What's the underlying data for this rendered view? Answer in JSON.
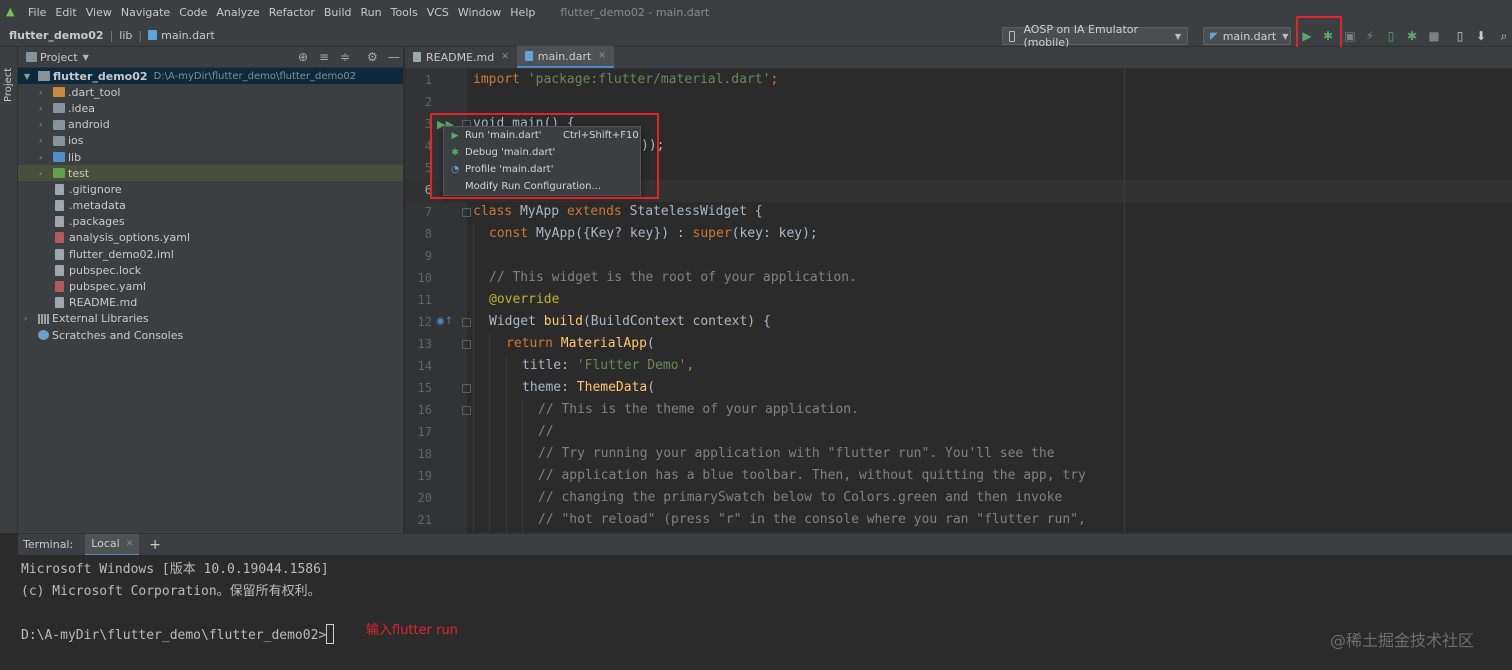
{
  "menubar": {
    "app_icon": "android-studio-icon",
    "items": [
      "File",
      "Edit",
      "View",
      "Navigate",
      "Code",
      "Analyze",
      "Refactor",
      "Build",
      "Run",
      "Tools",
      "VCS",
      "Window",
      "Help"
    ],
    "window_title": "flutter_demo02 - main.dart"
  },
  "navbar": {
    "breadcrumb": [
      "flutter_demo02",
      "lib",
      "main.dart"
    ],
    "device_selector": "AOSP on IA Emulator (mobile)",
    "run_config": "main.dart",
    "icons": [
      "run-icon",
      "debug-icon",
      "run-coverage-icon",
      "attach-icon",
      "apply-changes-icon",
      "debugger-icon",
      "stop-icon",
      "device-manager-icon",
      "sdk-manager-icon",
      "search-icon"
    ]
  },
  "stripe": {
    "label": "Project"
  },
  "project": {
    "title": "Project",
    "tree": [
      {
        "label": "flutter_demo02",
        "hint": "D:\\A-myDir\\flutter_demo\\flutter_demo02",
        "icon": "folder",
        "level": 0,
        "expanded": true
      },
      {
        "label": ".dart_tool",
        "icon": "folder-orange",
        "level": 1
      },
      {
        "label": ".idea",
        "icon": "folder",
        "level": 1
      },
      {
        "label": "android",
        "icon": "folder",
        "level": 1
      },
      {
        "label": "ios",
        "icon": "folder",
        "level": 1
      },
      {
        "label": "lib",
        "icon": "folder-blue",
        "level": 1
      },
      {
        "label": "test",
        "icon": "folder-green",
        "level": 1
      },
      {
        "label": ".gitignore",
        "icon": "file",
        "level": 1
      },
      {
        "label": ".metadata",
        "icon": "file",
        "level": 1
      },
      {
        "label": ".packages",
        "icon": "file",
        "level": 1
      },
      {
        "label": "analysis_options.yaml",
        "icon": "file-yaml",
        "level": 1
      },
      {
        "label": "flutter_demo02.iml",
        "icon": "file",
        "level": 1
      },
      {
        "label": "pubspec.lock",
        "icon": "file",
        "level": 1
      },
      {
        "label": "pubspec.yaml",
        "icon": "file-yaml",
        "level": 1
      },
      {
        "label": "README.md",
        "icon": "file",
        "level": 1
      },
      {
        "label": "External Libraries",
        "icon": "library",
        "level": 0
      },
      {
        "label": "Scratches and Consoles",
        "icon": "scratch",
        "level": 0
      }
    ]
  },
  "editor": {
    "tabs": [
      {
        "label": "README.md",
        "active": false
      },
      {
        "label": "main.dart",
        "active": true
      }
    ],
    "line_numbers": [
      "1",
      "2",
      "3",
      "4",
      "5",
      "6",
      "7",
      "8",
      "9",
      "10",
      "11",
      "12",
      "13",
      "14",
      "15",
      "16",
      "17",
      "18",
      "19",
      "20",
      "21"
    ],
    "code": {
      "l1a": "import ",
      "l1b": "'package:flutter/material.dart'",
      "l1c": ";",
      "l3": "void main() {",
      "l4": "));",
      "l7a": "class ",
      "l7b": "MyApp ",
      "l7c": "extends ",
      "l7d": "StatelessWidget {",
      "l8a": "const ",
      "l8b": "MyApp({Key? key}) : ",
      "l8c": "super",
      "l8d": "(key: key);",
      "l10": "// This widget is the root of your application.",
      "l11": "@override",
      "l12a": "Widget ",
      "l12b": "build",
      "l12c": "(BuildContext context) {",
      "l13a": "return ",
      "l13b": "MaterialApp",
      "l13c": "(",
      "l14a": "title: ",
      "l14b": "'Flutter Demo'",
      "l14c": ",",
      "l15a": "theme: ",
      "l15b": "ThemeData",
      "l15c": "(",
      "l16": "// This is the theme of your application.",
      "l17": "//",
      "l18": "// Try running your application with \"flutter run\". You'll see the",
      "l19": "// application has a blue toolbar. Then, without quitting the app, try",
      "l20": "// changing the primarySwatch below to Colors.green and then invoke",
      "l21": "// \"hot reload\" (press \"r\" in the console where you ran \"flutter run\","
    }
  },
  "popup": {
    "items": [
      {
        "label": "Run 'main.dart'",
        "shortcut": "Ctrl+Shift+F10",
        "icon": "run-icon"
      },
      {
        "label": "Debug 'main.dart'",
        "shortcut": "",
        "icon": "debug-icon"
      },
      {
        "label": "Profile 'main.dart'",
        "shortcut": "",
        "icon": "profile-icon"
      },
      {
        "label": "Modify Run Configuration...",
        "shortcut": "",
        "icon": ""
      }
    ]
  },
  "terminal": {
    "title": "Terminal:",
    "tab": "Local",
    "lines": [
      "Microsoft Windows [版本 10.0.19044.1586]",
      "(c) Microsoft Corporation。保留所有权利。",
      "",
      "D:\\A-myDir\\flutter_demo\\flutter_demo02>"
    ]
  },
  "annotation": "输入flutter run",
  "watermark": "@稀土掘金技术社区",
  "colors": {
    "accent": "#4a88c7",
    "highlight": "#e0242b",
    "run_green": "#59a869"
  }
}
